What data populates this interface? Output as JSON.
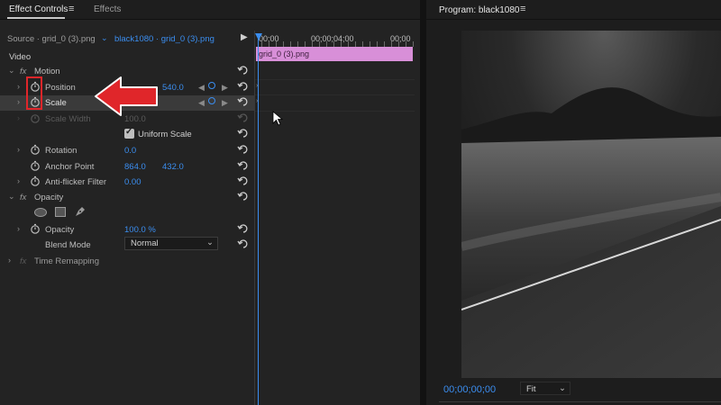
{
  "effect_controls": {
    "tab_label": "Effect Controls",
    "effects_tab_label": "Effects",
    "source_label": "Source · grid_0 (3).png",
    "sequence_label": "black1080 · grid_0 (3).png",
    "timecodes": [
      "00;00",
      "00;00;04;00",
      "00;00"
    ],
    "clip_name": "grid_0 (3).png",
    "video_header": "Video",
    "fx_symbol": "fx",
    "motion_label": "Motion",
    "position": {
      "label": "Position",
      "value": "540.0"
    },
    "scale": {
      "label": "Scale"
    },
    "scale_width": {
      "label": "Scale Width",
      "value": "100.0"
    },
    "uniform_scale": {
      "label": "Uniform Scale",
      "checked": true
    },
    "rotation": {
      "label": "Rotation",
      "value": "0.0"
    },
    "anchor_point": {
      "label": "Anchor Point",
      "x": "864.0",
      "y": "432.0"
    },
    "anti_flicker": {
      "label": "Anti-flicker Filter",
      "value": "0.00"
    },
    "opacity_section": "Opacity",
    "opacity": {
      "label": "Opacity",
      "value": "100.0 %"
    },
    "blend_mode": {
      "label": "Blend Mode",
      "value": "Normal"
    },
    "time_remapping": "Time Remapping"
  },
  "program_monitor": {
    "title": "Program: black1080",
    "timecode": "00;00;00;00",
    "fit_value": "Fit"
  },
  "colors": {
    "accent_blue": "#3b8ef0",
    "clip_pink": "#d88fd8",
    "highlight_red": "#e0262a"
  },
  "icons": [
    "menu-icon",
    "stopwatch-icon",
    "reset-icon",
    "twirl-icon",
    "keyframe-icon",
    "play-icon",
    "pen-mask-icon",
    "ellipse-mask-icon",
    "rectangle-mask-icon",
    "red-arrow-icon",
    "cursor-icon"
  ]
}
